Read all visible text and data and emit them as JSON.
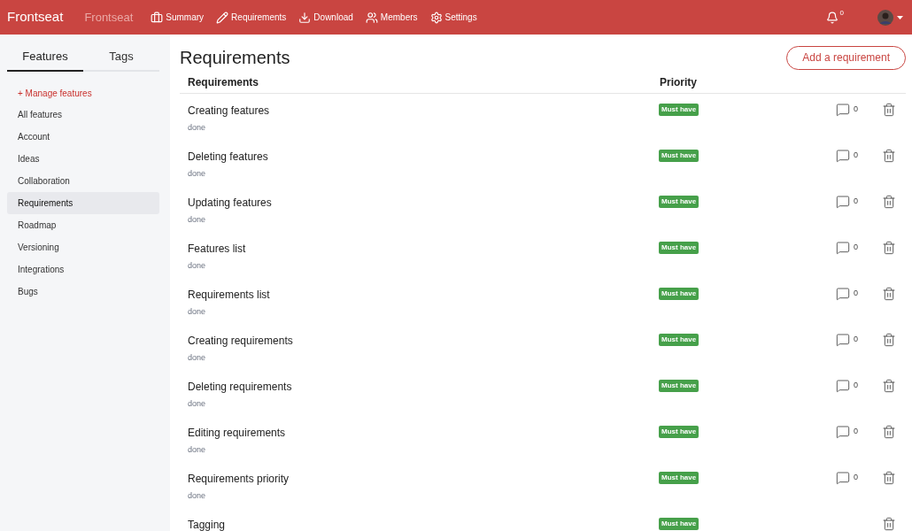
{
  "navbar": {
    "brand": "Frontseat",
    "project": "Frontseat",
    "links": [
      {
        "kind": "briefcase",
        "label": "Summary"
      },
      {
        "kind": "pencil",
        "label": "Requirements"
      },
      {
        "kind": "download",
        "label": "Download"
      },
      {
        "kind": "users",
        "label": "Members"
      },
      {
        "kind": "gear",
        "label": "Settings"
      }
    ],
    "notifications": "0"
  },
  "sidebar": {
    "tabs": [
      {
        "label": "Features",
        "selected": true
      },
      {
        "label": "Tags",
        "selected": false
      }
    ],
    "manage": "+ Manage features",
    "items": [
      {
        "label": "All features",
        "selected": false
      },
      {
        "label": "Account",
        "selected": false
      },
      {
        "label": "Ideas",
        "selected": false
      },
      {
        "label": "Collaboration",
        "selected": false
      },
      {
        "label": "Requirements",
        "selected": true
      },
      {
        "label": "Roadmap",
        "selected": false
      },
      {
        "label": "Versioning",
        "selected": false
      },
      {
        "label": "Integrations",
        "selected": false
      },
      {
        "label": "Bugs",
        "selected": false
      }
    ]
  },
  "page": {
    "title": "Requirements",
    "add_button": "Add a requirement"
  },
  "table": {
    "columns": [
      "Requirements",
      "Priority"
    ],
    "rows": [
      {
        "name": "Creating features",
        "status": "done",
        "priority": "Must have",
        "comments": "0"
      },
      {
        "name": "Deleting features",
        "status": "done",
        "priority": "Must have",
        "comments": "0"
      },
      {
        "name": "Updating features",
        "status": "done",
        "priority": "Must have",
        "comments": "0"
      },
      {
        "name": "Features list",
        "status": "done",
        "priority": "Must have",
        "comments": "0"
      },
      {
        "name": "Requirements list",
        "status": "done",
        "priority": "Must have",
        "comments": "0"
      },
      {
        "name": "Creating requirements",
        "status": "done",
        "priority": "Must have",
        "comments": "0"
      },
      {
        "name": "Deleting requirements",
        "status": "done",
        "priority": "Must have",
        "comments": "0"
      },
      {
        "name": "Editing requirements",
        "status": "done",
        "priority": "Must have",
        "comments": "0"
      },
      {
        "name": "Requirements priority",
        "status": "done",
        "priority": "Must have",
        "comments": "0"
      },
      {
        "name": "Tagging",
        "priority": "Must have"
      }
    ]
  }
}
